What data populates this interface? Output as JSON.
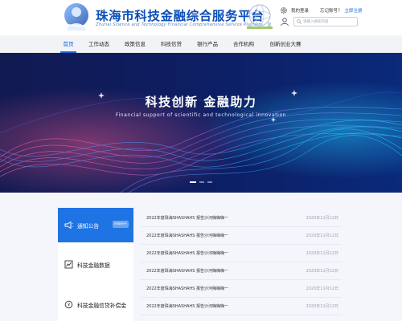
{
  "header": {
    "title": "珠海市科技金融综合服务平台",
    "subtitle": "Zhuhai Science and Technology Financial Comprehensive Service Platform",
    "login": "我的登录",
    "forgot": "忘记账号？",
    "register": "立即注册",
    "search_placeholder": "请输入搜索内容"
  },
  "nav": {
    "items": [
      {
        "label": "首页",
        "active": true
      },
      {
        "label": "工作动态"
      },
      {
        "label": "政策信息"
      },
      {
        "label": "科技信贷"
      },
      {
        "label": "银行产品"
      },
      {
        "label": "合作机构"
      },
      {
        "label": "创新创业大赛"
      }
    ]
  },
  "banner": {
    "title": "科技创新  金融助力",
    "subtitle": "Financial support of scientific and technological innovation",
    "slide_count": 3,
    "active_slide": 1
  },
  "sidebar": {
    "items": [
      {
        "label": "通知公告",
        "icon": "megaphone-icon",
        "active": true,
        "badge": "more+"
      },
      {
        "label": "科技金融数据",
        "icon": "chart-icon"
      },
      {
        "label": "科技金融信贷补偿金",
        "icon": "coin-icon"
      }
    ]
  },
  "news": {
    "items": [
      {
        "title": "2022年度珠海SHASHAHS 报告沙河嗨嗨嗨一",
        "date": "2020年11月12日"
      },
      {
        "title": "2022年度珠海SHASHAHS 报告沙河嗨嗨嗨一",
        "date": "2020年11月12日"
      },
      {
        "title": "2022年度珠海SHASHAHS 报告沙河嗨嗨嗨一",
        "date": "2020年11月12日"
      },
      {
        "title": "2022年度珠海SHASHAHS 报告沙河嗨嗨嗨一",
        "date": "2020年11月12日"
      },
      {
        "title": "2022年度珠海SHASHAHS 报告沙河嗨嗨嗨一",
        "date": "2020年11月12日"
      },
      {
        "title": "2022年度珠海SHASHAHS 报告沙河嗨嗨嗨一",
        "date": "2020年11月12日"
      }
    ]
  },
  "colors": {
    "brand_blue": "#1562d6",
    "sidebar_active": "#1f74e5",
    "banner_bg": "#0c1446"
  }
}
